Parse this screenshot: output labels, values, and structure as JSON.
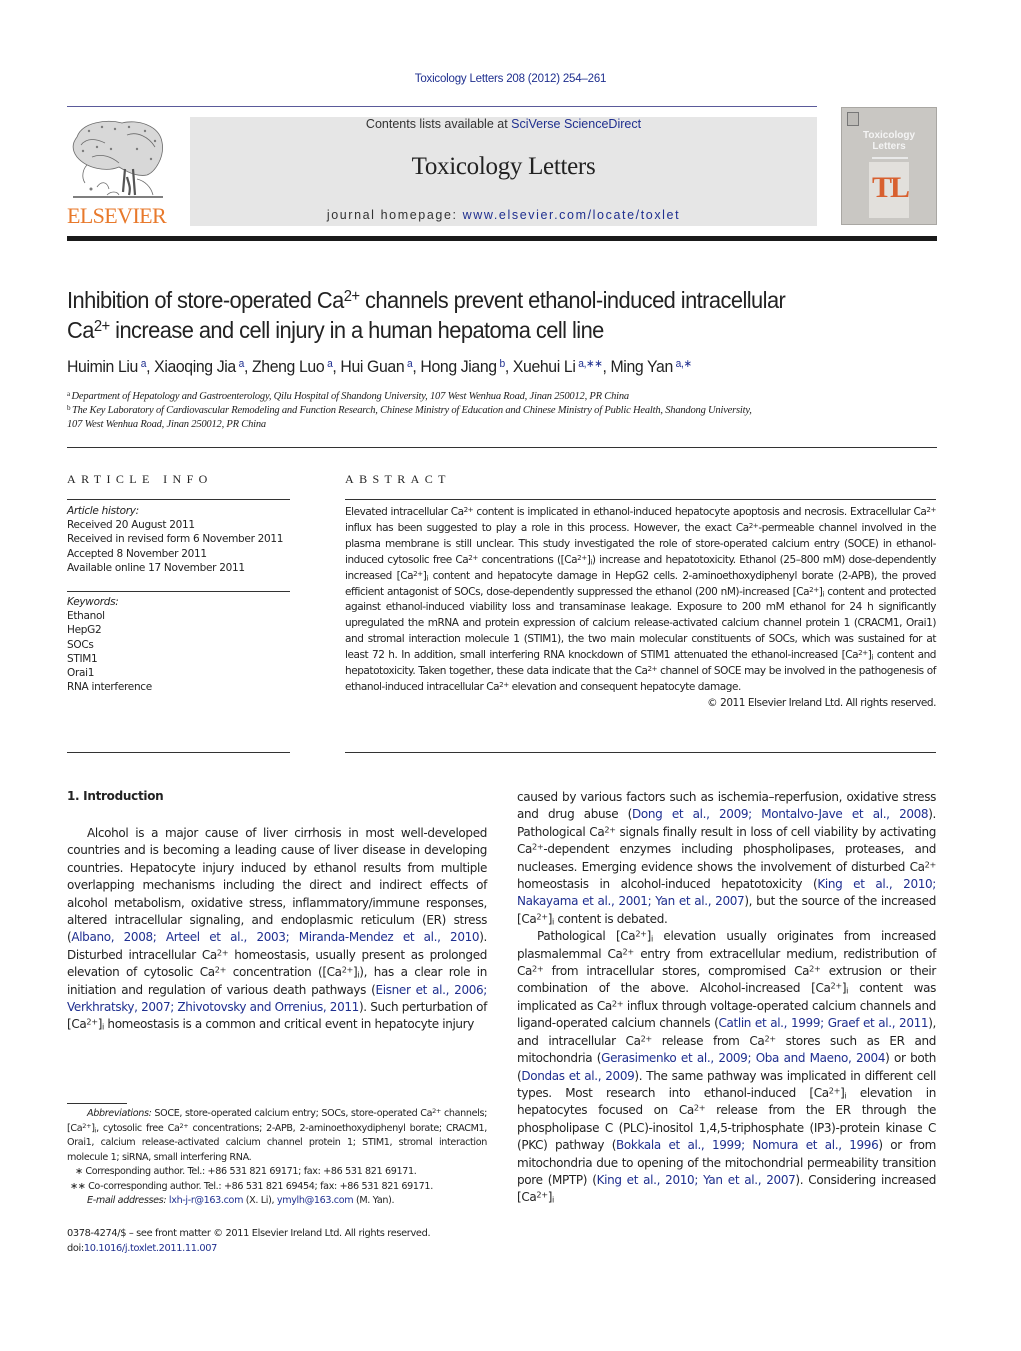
{
  "header": {
    "journal_ref": "Toxicology Letters 208 (2012) 254–261",
    "contents_prefix": "Contents lists available at ",
    "contents_link": "SciVerse ScienceDirect",
    "journal_title": "Toxicology Letters",
    "homepage_prefix": "journal homepage: ",
    "homepage_link": "www.elsevier.com/locate/toxlet",
    "publisher_logo_text": "ELSEVIER",
    "cover": {
      "title_line1": "Toxicology",
      "title_line2": "Letters",
      "monogram": "TL"
    },
    "colors": {
      "link": "#1f2f8f",
      "elsevier_orange": "#e8792b",
      "banner_bg": "#e6e6e6",
      "cover_tl": "#d8602f"
    }
  },
  "article": {
    "title_part1": "Inhibition of store-operated Ca",
    "title_sup1": "2+",
    "title_part2": " channels prevent ethanol-induced intracellular",
    "title_line2_part1": "Ca",
    "title_sup2": "2+",
    "title_line2_part2": " increase and cell injury in a human hepatoma cell line",
    "authors": [
      {
        "name": "Huimin Liu",
        "sup": "a"
      },
      {
        "name": "Xiaoqing Jia",
        "sup": "a"
      },
      {
        "name": "Zheng Luo",
        "sup": "a"
      },
      {
        "name": "Hui Guan",
        "sup": "a"
      },
      {
        "name": "Hong Jiang",
        "sup": "b"
      },
      {
        "name": "Xuehui Li",
        "sup": "a,∗∗"
      },
      {
        "name": "Ming Yan",
        "sup": "a,∗"
      }
    ],
    "affiliations": [
      {
        "key": "a",
        "text": "Department of Hepatology and Gastroenterology, Qilu Hospital of Shandong University, 107 West Wenhua Road, Jinan 250012, PR China"
      },
      {
        "key": "b",
        "text": "The Key Laboratory of Cardiovascular Remodeling and Function Research, Chinese Ministry of Education and Chinese Ministry of Public Health, Shandong University,"
      },
      {
        "key": "",
        "text": "107 West Wenhua Road, Jinan 250012, PR China"
      }
    ]
  },
  "article_info": {
    "label": "ARTICLE INFO",
    "history_label": "Article history:",
    "history": [
      "Received 20 August 2011",
      "Received in revised form 6 November 2011",
      "Accepted 8 November 2011",
      "Available online 17 November 2011"
    ],
    "keywords_label": "Keywords:",
    "keywords": [
      "Ethanol",
      "HepG2",
      "SOCs",
      "STIM1",
      "Orai1",
      "RNA interference"
    ]
  },
  "abstract": {
    "label": "ABSTRACT",
    "text_html": "Elevated intracellular Ca<sup>2+</sup> content is implicated in ethanol-induced hepatocyte apoptosis and necrosis. Extracellular Ca<sup>2+</sup> influx has been suggested to play a role in this process. However, the exact Ca<sup>2+</sup>-permeable channel involved in the plasma membrane is still unclear. This study investigated the role of store-operated calcium entry (SOCE) in ethanol-induced cytosolic free Ca<sup>2+</sup> concentrations ([Ca<sup>2+</sup>]<sub>i</sub>) increase and hepatotoxicity. Ethanol (25–800 mM) dose-dependently increased [Ca<sup>2+</sup>]<sub>i</sub> content and hepatocyte damage in HepG2 cells. 2-aminoethoxydiphenyl borate (2-APB), the proved efficient antagonist of SOCs, dose-dependently suppressed the ethanol (200 nM)-increased [Ca<sup>2+</sup>]<sub>i</sub> content and protected against ethanol-induced viability loss and transaminase leakage. Exposure to 200 mM ethanol for 24 h significantly upregulated the mRNA and protein expression of calcium release-activated calcium channel protein 1 (CRACM1, Orai1) and stromal interaction molecule 1 (STIM1), the two main molecular constituents of SOCs, which was sustained for at least 72 h. In addition, small interfering RNA knockdown of STIM1 attenuated the ethanol-increased [Ca<sup>2+</sup>]<sub>i</sub> content and hepatotoxicity. Taken together, these data indicate that the Ca<sup>2+</sup> channel of SOCE may be involved in the pathogenesis of ethanol-induced intracellular Ca<sup>2+</sup> elevation and consequent hepatocyte damage.",
    "copyright": "© 2011 Elsevier Ireland Ltd. All rights reserved."
  },
  "body": {
    "intro_heading": "1.  Introduction",
    "left_para_html": "Alcohol is a major cause of liver cirrhosis in most well-developed countries and is becoming a leading cause of liver disease in developing countries. Hepatocyte injury induced by ethanol results from multiple overlapping mechanisms including the direct and indirect effects of alcohol metabolism, oxidative stress, inflammatory/immune responses, altered intracellular signaling, and endoplasmic reticulum (ER) stress (<span class=\"lnk\">Albano, 2008; Arteel et al., 2003; Miranda-Mendez et al., 2010</span>). Disturbed intracellular Ca<sup>2+</sup> homeostasis, usually present as prolonged elevation of cytosolic Ca<sup>2+</sup> concentration ([Ca<sup>2+</sup>]<sub>i</sub>), has a clear role in initiation and regulation of various death pathways (<span class=\"lnk\">Eisner et al., 2006; Verkhratsky, 2007; Zhivotovsky and Orrenius, 2011</span>). Such perturbation of [Ca<sup>2+</sup>]<sub>i</sub> homeostasis is a common and critical event in hepatocyte injury",
    "right_para1_html": "caused by various factors such as ischemia–reperfusion, oxidative stress and drug abuse (<span class=\"lnk\">Dong et al., 2009; Montalvo-Jave et al., 2008</span>). Pathological Ca<sup>2+</sup> signals finally result in loss of cell viability by activating Ca<sup>2+</sup>-dependent enzymes including phospholipases, proteases, and nucleases. Emerging evidence shows the involvement of disturbed Ca<sup>2+</sup> homeostasis in alcohol-induced hepatotoxicity (<span class=\"lnk\">King et al., 2010; Nakayama et al., 2001; Yan et al., 2007</span>), but the source of the increased [Ca<sup>2+</sup>]<sub>i</sub> content is debated.",
    "right_para2_html": "Pathological [Ca<sup>2+</sup>]<sub>i</sub> elevation usually originates from increased plasmalemmal Ca<sup>2+</sup> entry from extracellular medium, redistribution of Ca<sup>2+</sup> from intracellular stores, compromised Ca<sup>2+</sup> extrusion or their combination of the above. Alcohol-increased [Ca<sup>2+</sup>]<sub>i</sub> content was implicated as Ca<sup>2+</sup> influx through voltage-operated calcium channels and ligand-operated calcium channels (<span class=\"lnk\">Catlin et al., 1999; Graef et al., 2011</span>), and intracellular Ca<sup>2+</sup> release from Ca<sup>2+</sup> stores such as ER and mitochondria (<span class=\"lnk\">Gerasimenko et al., 2009; Oba and Maeno, 2004</span>) or both (<span class=\"lnk\">Dondas et al., 2009</span>). The same pathway was implicated in different cell types. Most research into ethanol-induced [Ca<sup>2+</sup>]<sub>i</sub> elevation in hepatocytes focused on Ca<sup>2+</sup> release from the ER through the phospholipase C (PLC)-inositol 1,4,5-triphosphate (IP3)-protein kinase C (PKC) pathway (<span class=\"lnk\">Bokkala et al., 1999; Nomura et al., 1996</span>) or from mitochondria due to opening of the mitochondrial permeability transition pore (MPTP) (<span class=\"lnk\">King et al., 2010; Yan et al., 2007</span>). Considering increased [Ca<sup>2+</sup>]<sub>i</sub>"
  },
  "footnotes": {
    "abbrev_label": "Abbreviations:",
    "abbrev_html": " SOCE, store-operated calcium entry; SOCs, store-operated Ca<sup>2+</sup> channels; [Ca<sup>2+</sup>]<sub>i</sub>, cytosolic free Ca<sup>2+</sup> concentrations; 2-APB, 2-aminoethoxydiphenyl borate; CRACM1, Orai1, calcium release-activated calcium channel protein 1; STIM1, stromal interaction molecule 1; siRNA, small interfering RNA.",
    "corresponding": "∗  Corresponding author. Tel.: +86 531 821 69171; fax: +86 531 821 69171.",
    "co_corresponding": "∗∗  Co-corresponding author. Tel.: +86 531 821 69454; fax: +86 531 821 69171.",
    "email_label": "E-mail addresses:",
    "emails": [
      {
        "address": "lxh-j-r@163.com",
        "owner": " (X. Li), "
      },
      {
        "address": "ymylh@163.com",
        "owner": " (M. Yan)."
      }
    ]
  },
  "front_matter": {
    "issn_line": "0378-4274/$ – see front matter © 2011 Elsevier Ireland Ltd. All rights reserved.",
    "doi_prefix": "doi:",
    "doi": "10.1016/j.toxlet.2011.11.007"
  }
}
